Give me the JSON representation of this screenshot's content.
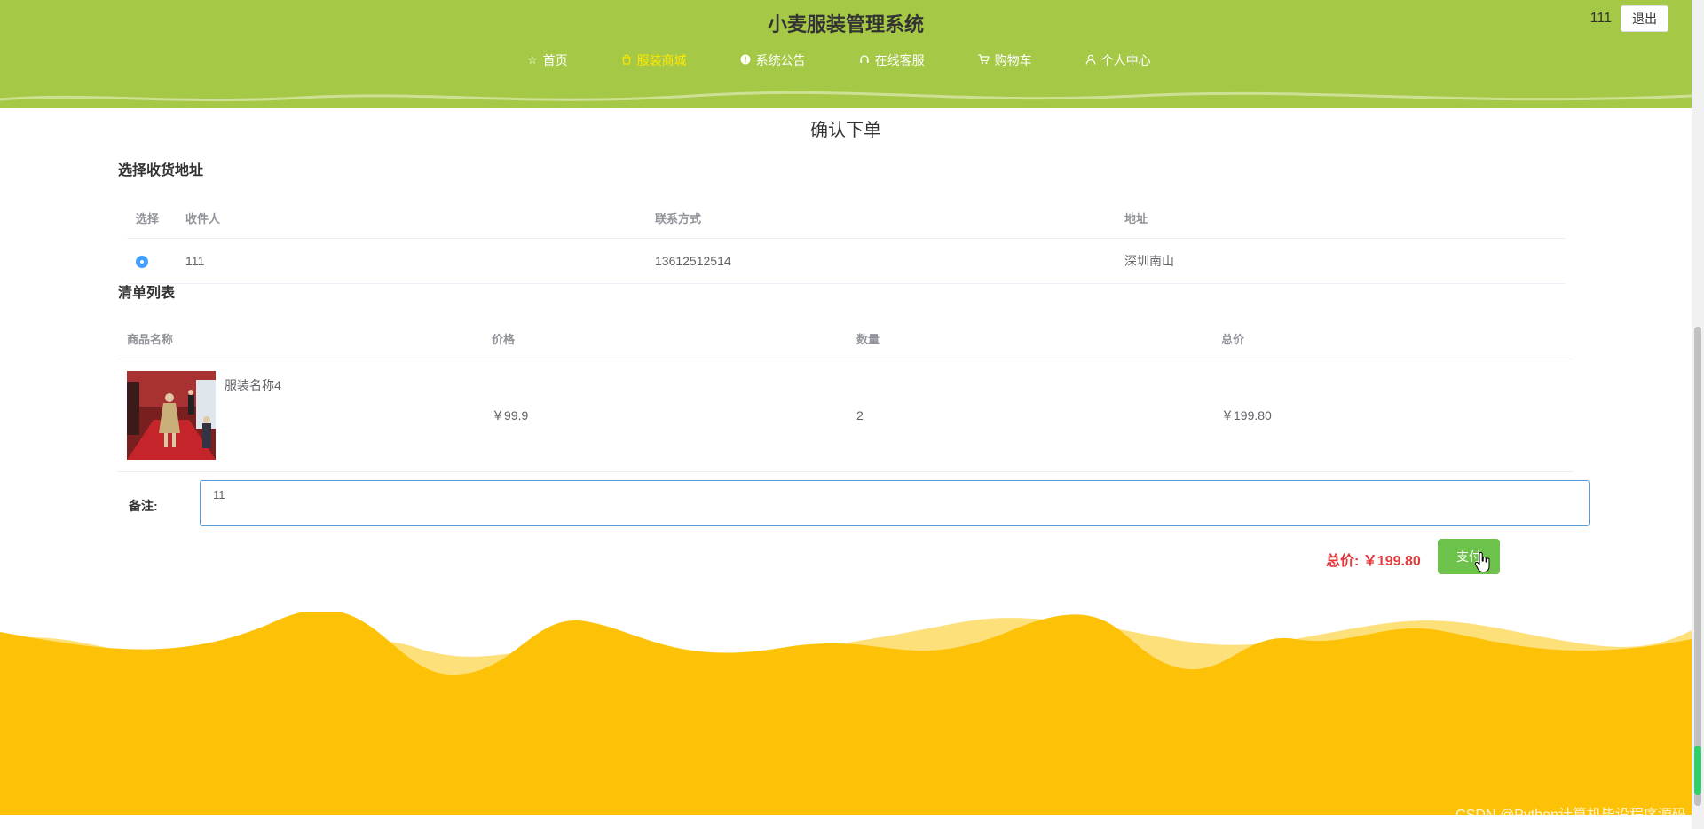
{
  "header": {
    "site_title": "小麦服装管理系统",
    "username": "111",
    "logout_label": "退出",
    "nav": [
      {
        "label": "首页",
        "icon": "star-icon"
      },
      {
        "label": "服装商城",
        "icon": "shopping-bag-icon",
        "active": true
      },
      {
        "label": "系统公告",
        "icon": "info-icon"
      },
      {
        "label": "在线客服",
        "icon": "headset-icon"
      },
      {
        "label": "购物车",
        "icon": "cart-icon"
      },
      {
        "label": "个人中心",
        "icon": "user-icon"
      }
    ]
  },
  "main": {
    "page_title": "确认下单",
    "address_section": {
      "title": "选择收货地址",
      "columns": [
        "选择",
        "收件人",
        "联系方式",
        "地址"
      ],
      "rows": [
        {
          "selected": true,
          "recipient": "111",
          "phone": "13612512514",
          "address": "深圳南山"
        }
      ]
    },
    "items_section": {
      "title": "清单列表",
      "columns": [
        "商品名称",
        "价格",
        "数量",
        "总价"
      ],
      "rows": [
        {
          "name": "服装名称4",
          "price": "￥99.9",
          "quantity": "2",
          "total": "￥199.80"
        }
      ]
    },
    "remark": {
      "label": "备注:",
      "value": "11"
    },
    "total": {
      "label": "总价:",
      "value": "￥199.80"
    },
    "pay_label": "支付"
  },
  "watermark": "CSDN @Python计算机毕设程序源码",
  "colors": {
    "header_bg": "#a5c946",
    "nav_active": "#ffe600",
    "price_red": "#e4393c",
    "pay_green": "#6cc24a",
    "footer_yellow": "#fdc207"
  }
}
